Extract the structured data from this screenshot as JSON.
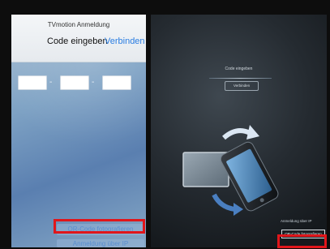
{
  "phone": {
    "app_title": "TVmotion Anmeldung",
    "code_heading": "Code eingeben",
    "connect_label": "Verbinden",
    "qr_button": "QR-Code fotografieren",
    "ip_button": "Anmeldung über IP"
  },
  "tv": {
    "title": "Code eingeben",
    "connect_button": "Verbinden",
    "ip_link": "Anmeldung über IP",
    "qr_button": "QR-Code fotografieren"
  },
  "colors": {
    "highlight": "#e0161b",
    "link_blue": "#2a7de1"
  }
}
